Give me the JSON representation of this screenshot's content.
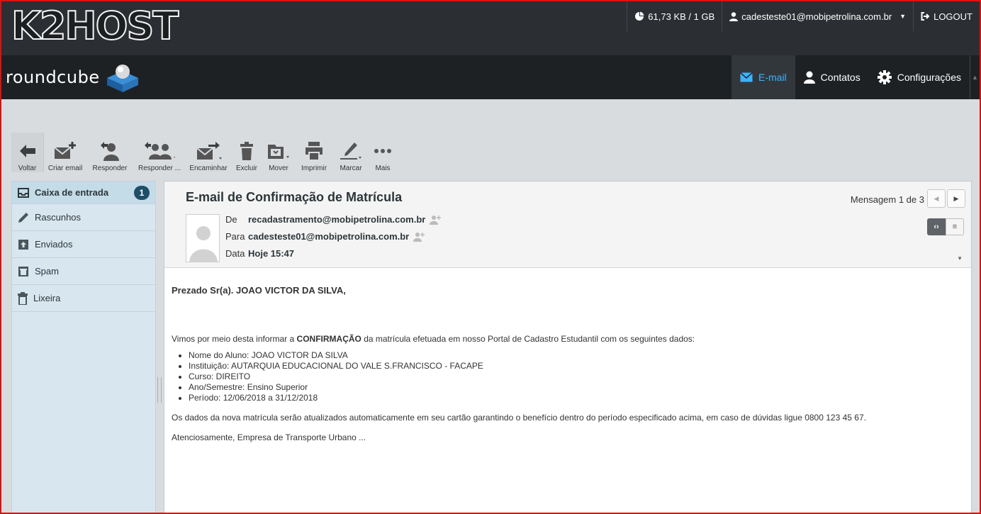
{
  "brand": {
    "logo_text": "K2HOST",
    "app_name": "roundcube"
  },
  "topbar": {
    "quota": "61,73 KB / 1 GB",
    "user": "cadesteste01@mobipetrolina.com.br",
    "logout": "LOGOUT"
  },
  "nav": {
    "tabs": [
      {
        "label": "E-mail",
        "icon": "envelope-icon",
        "active": true
      },
      {
        "label": "Contatos",
        "icon": "person-icon"
      },
      {
        "label": "Configurações",
        "icon": "gear-icon"
      }
    ]
  },
  "toolbar": {
    "buttons": [
      {
        "label": "Voltar",
        "icon": "arrow-left-icon"
      },
      {
        "label": "Criar email",
        "icon": "compose-icon"
      },
      {
        "label": "Responder",
        "icon": "reply-icon"
      },
      {
        "label": "Responder ...",
        "icon": "reply-all-icon"
      },
      {
        "label": "Encaminhar",
        "icon": "forward-icon"
      },
      {
        "label": "Excluir",
        "icon": "trash-icon"
      },
      {
        "label": "Mover",
        "icon": "folder-move-icon"
      },
      {
        "label": "Imprimir",
        "icon": "print-icon"
      },
      {
        "label": "Marcar",
        "icon": "pencil-icon"
      },
      {
        "label": "Mais",
        "icon": "more-dots-icon"
      }
    ]
  },
  "folders": [
    {
      "label": "Caixa de entrada",
      "count": "1",
      "selected": true,
      "icon": "inbox-icon"
    },
    {
      "label": "Rascunhos",
      "icon": "pencil-icon"
    },
    {
      "label": "Enviados",
      "icon": "sent-icon"
    },
    {
      "label": "Spam",
      "icon": "spam-icon"
    },
    {
      "label": "Lixeira",
      "icon": "trash-icon"
    }
  ],
  "message": {
    "subject": "E-mail de Confirmação de Matrícula",
    "counter": "Mensagem 1 de 3",
    "from_label": "De",
    "from": "recadastramento@mobipetrolina.com.br",
    "to_label": "Para",
    "to": "cadesteste01@mobipetrolina.com.br",
    "date_label": "Data",
    "date": "Hoje 15:47",
    "greeting": "Prezado Sr(a). JOAO VICTOR DA SILVA,",
    "intro_before": "Vimos por meio desta informar a ",
    "intro_bold": "CONFIRMAÇÃO",
    "intro_after": " da matrícula efetuada em nosso Portal de Cadastro Estudantil com os seguintes dados:",
    "details": [
      "Nome do Aluno: JOAO VICTOR DA SILVA",
      "Instituição: AUTARQUIA EDUCACIONAL DO VALE S.FRANCISCO - FACAPE",
      "Curso: DIREITO",
      "Ano/Semestre: Ensino Superior",
      "Período: 12/06/2018 a 31/12/2018"
    ],
    "notice": "Os dados da nova matrícula serão atualizados automaticamente em seu cartão garantindo o benefício dentro do período especificado acima, em caso de dúvidas ligue 0800 123 45 67.",
    "signoff": "Atenciosamente, Empresa de Transporte Urbano ..."
  },
  "colors": {
    "accent": "#3db3ff",
    "topbar": "#2b2f33",
    "navbar": "#1e2124",
    "sidebar": "#d8e6ef",
    "badge": "#1f4f68",
    "frame": "#dd1111"
  }
}
